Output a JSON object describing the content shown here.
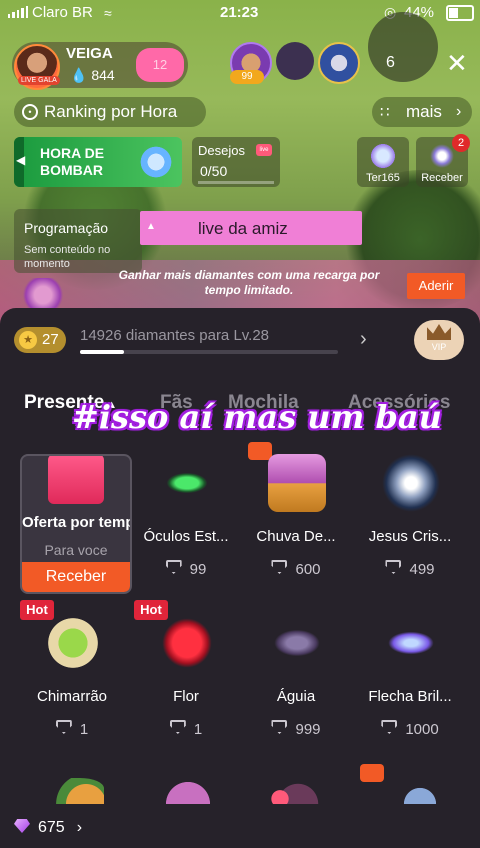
{
  "status_bar": {
    "carrier": "Claro BR",
    "time": "21:23",
    "battery": "44%",
    "battery_level": 0.44
  },
  "host": {
    "name": "VEIGA",
    "tag": "LIVE GALA",
    "follower_count": "844",
    "hearts": "12"
  },
  "viewers": {
    "first_badge": "99",
    "count": "6"
  },
  "top_pills": {
    "ranking": "Ranking por Hora",
    "more": "mais"
  },
  "banner": {
    "line1": "HORA DE",
    "line2": "BOMBAR"
  },
  "wishes": {
    "label": "Desejos",
    "value": "0/50",
    "icon_text": "live"
  },
  "tiles": {
    "ter": "Ter165",
    "receber": "Receber",
    "receber_badge": "2"
  },
  "programacao": {
    "title": "Programação",
    "subtitle": "Sem conteúdo no momento"
  },
  "pink_banner": {
    "text": "live  da amiz"
  },
  "promo": {
    "text": "Ganhar mais diamantes com uma recarga por tempo limitado.",
    "button": "Aderir"
  },
  "level": {
    "badge": "27",
    "progress_text": "14926 diamantes para Lv.28",
    "progress": 0.17,
    "vip": "VIP"
  },
  "tabs": [
    "Presente",
    "Fãs",
    "Mochila",
    "Acessórios"
  ],
  "sticker": "#isso aí mas um baú",
  "gifts": [
    {
      "name": "Oferta por tempo",
      "sub": "Para voce",
      "button": "Receber"
    },
    {
      "name": "Óculos Est...",
      "price": "99"
    },
    {
      "name": "Chuva De...",
      "price": "600"
    },
    {
      "name": "Jesus Cris...",
      "price": "499"
    },
    {
      "name": "Chimarrão",
      "price": "1",
      "hot": "Hot"
    },
    {
      "name": "Flor",
      "price": "1",
      "hot": "Hot"
    },
    {
      "name": "Águia",
      "price": "999"
    },
    {
      "name": "Flecha Bril...",
      "price": "1000"
    }
  ],
  "balance": "675",
  "icons": [
    "signal-icon",
    "wifi-icon",
    "lock-icon",
    "battery-icon",
    "close-icon",
    "clock-icon",
    "grid-icon",
    "chevron-right-icon",
    "diamond-icon",
    "heart-icon",
    "crown-icon"
  ]
}
